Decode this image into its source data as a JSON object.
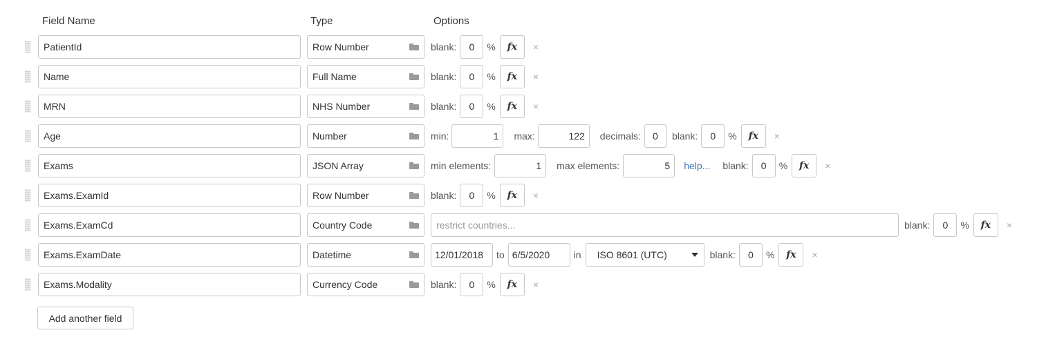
{
  "headers": {
    "field_name": "Field Name",
    "type": "Type",
    "options": "Options"
  },
  "labels": {
    "blank": "blank:",
    "percent": "%",
    "fx": "fx",
    "remove": "×",
    "min": "min:",
    "max": "max:",
    "decimals": "decimals:",
    "min_elements": "min elements:",
    "max_elements": "max elements:",
    "help": "help...",
    "to": "to",
    "in": "in"
  },
  "rows": [
    {
      "name": "PatientId",
      "type": "Row Number",
      "blank": "0"
    },
    {
      "name": "Name",
      "type": "Full Name",
      "blank": "0"
    },
    {
      "name": "MRN",
      "type": "NHS Number",
      "blank": "0"
    },
    {
      "name": "Age",
      "type": "Number",
      "blank": "0",
      "min": "1",
      "max": "122",
      "decimals": "0"
    },
    {
      "name": "Exams",
      "type": "JSON Array",
      "blank": "0",
      "min_elements": "1",
      "max_elements": "5"
    },
    {
      "name": "Exams.ExamId",
      "type": "Row Number",
      "blank": "0"
    },
    {
      "name": "Exams.ExamCd",
      "type": "Country Code",
      "blank": "0",
      "restrict_placeholder": "restrict countries..."
    },
    {
      "name": "Exams.ExamDate",
      "type": "Datetime",
      "blank": "0",
      "from": "12/01/2018",
      "to": "6/5/2020",
      "format": "ISO 8601 (UTC)"
    },
    {
      "name": "Exams.Modality",
      "type": "Currency Code",
      "blank": "0"
    }
  ],
  "add_button": "Add another field"
}
